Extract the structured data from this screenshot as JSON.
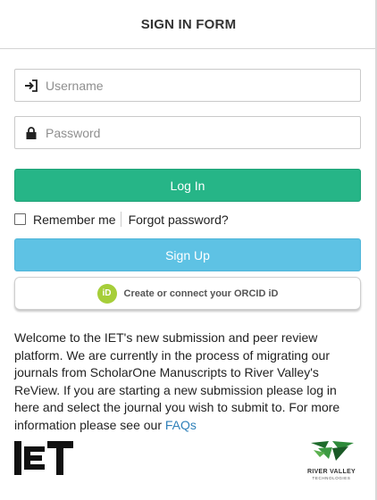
{
  "header": {
    "title": "SIGN IN FORM"
  },
  "form": {
    "username_placeholder": "Username",
    "password_placeholder": "Password",
    "login_label": "Log In",
    "remember_label": "Remember me",
    "forgot_label": "Forgot password?",
    "signup_label": "Sign Up",
    "orcid_label": "Create or connect your ORCID iD",
    "orcid_badge": "iD"
  },
  "welcome": {
    "text": "Welcome to the IET's new submission and peer review platform. We are currently in the process of migrating our journals from ScholarOne Manuscripts to River Valley's ReView. If you are starting a new submission please log in here and select the journal you wish to submit to. For more information please see our ",
    "faq_link": "FAQs"
  },
  "footer": {
    "iet_logo_text": "IET",
    "rv_name": "RIVER VALLEY",
    "rv_sub": "TECHNOLOGIES"
  },
  "colors": {
    "login": "#26b587",
    "signup": "#5ec2e4",
    "orcid": "#a6ce39",
    "link": "#2f80b9"
  }
}
